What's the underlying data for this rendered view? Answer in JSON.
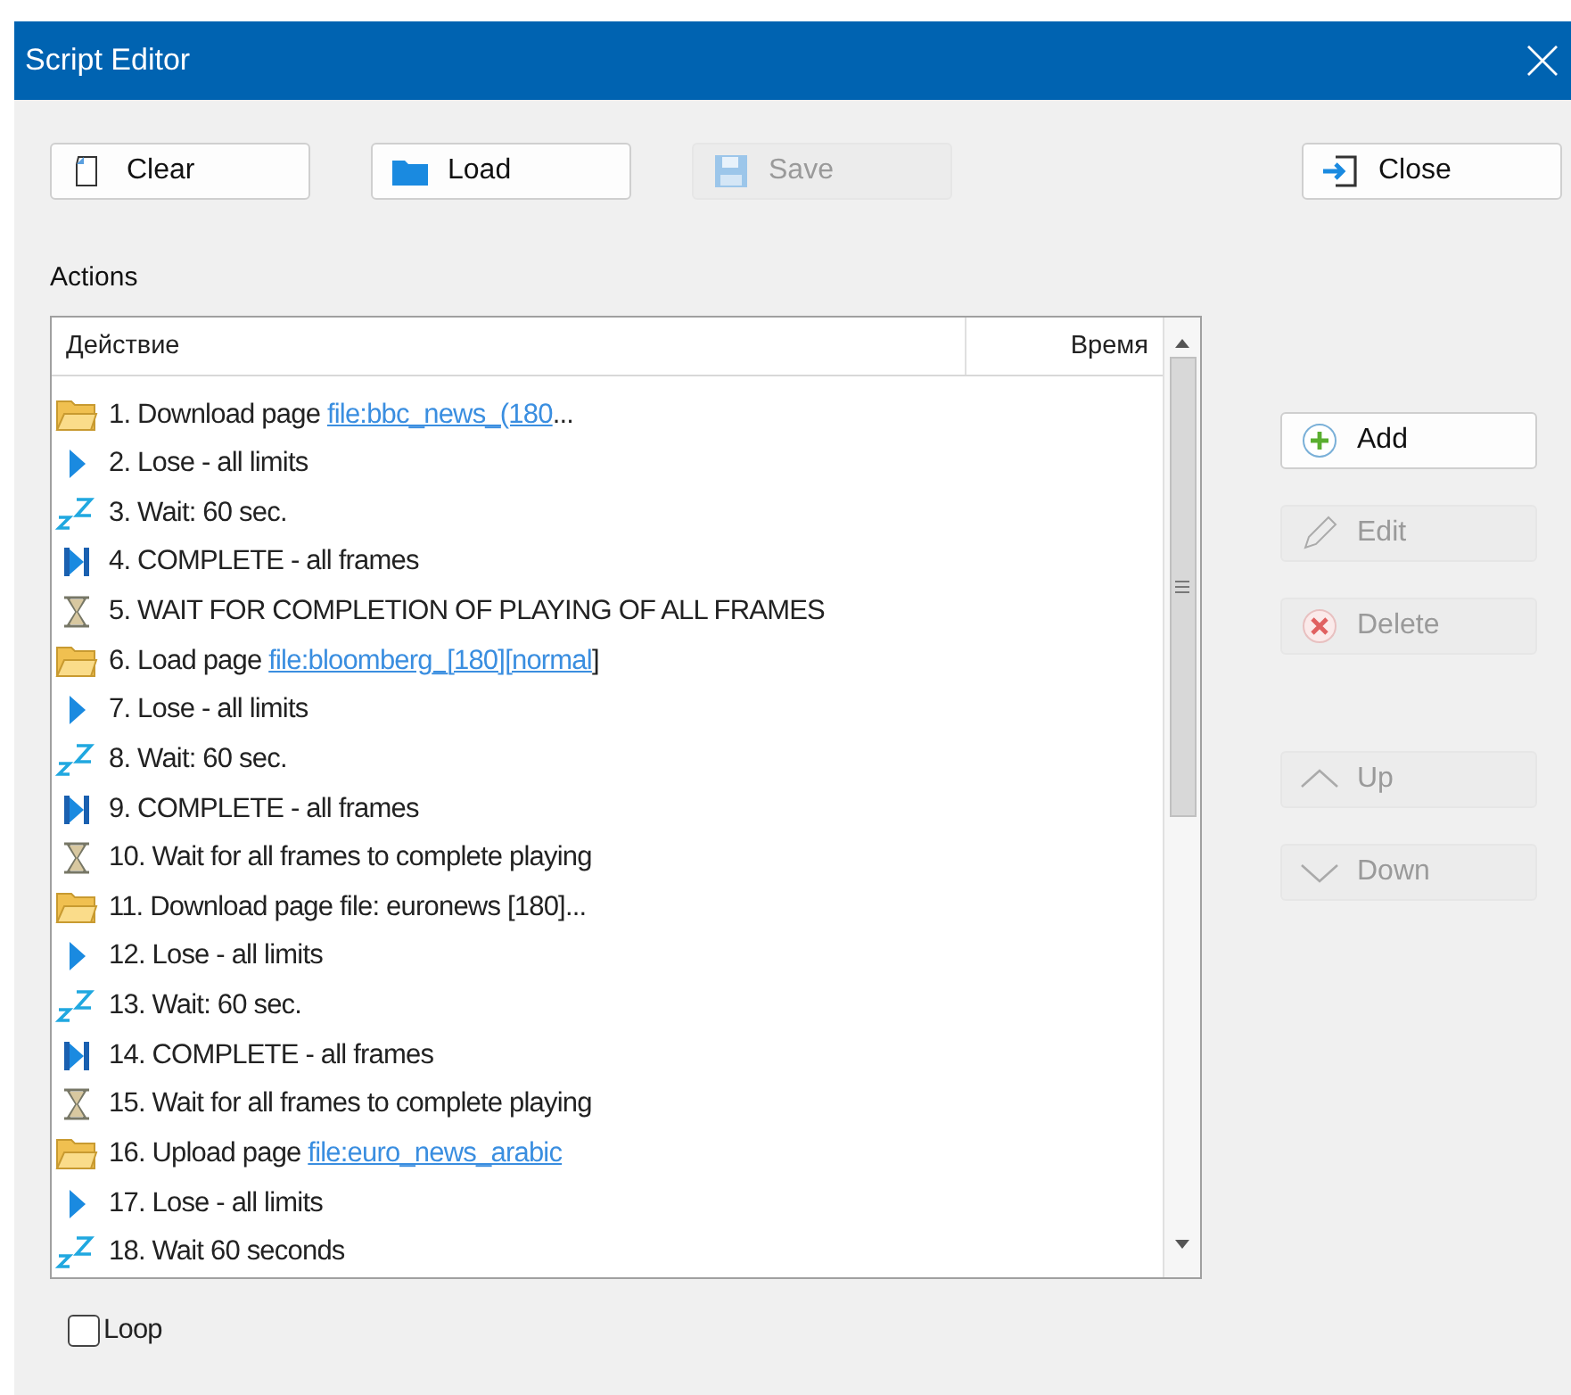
{
  "window": {
    "title": "Script Editor"
  },
  "toolbar": [
    {
      "label": "Clear",
      "kind": "page",
      "disabled": false
    },
    {
      "label": "Load",
      "kind": "folder",
      "disabled": false
    },
    {
      "label": "Save",
      "kind": "disk",
      "disabled": true
    }
  ],
  "close_button": {
    "label": "Close"
  },
  "actions_label": "Actions",
  "table": {
    "columns": [
      "Действие",
      "Время"
    ],
    "rows": [
      {
        "kind": "folder",
        "text": "1. Download page ",
        "link": "file:bbc_news_(180",
        "suffix": "..."
      },
      {
        "kind": "play",
        "text": "2. Lose - all limits"
      },
      {
        "kind": "sleep",
        "text": "3. Wait: 60 sec."
      },
      {
        "kind": "skip",
        "text": "4. COMPLETE - all frames"
      },
      {
        "kind": "hourglass",
        "text": "5. WAIT FOR COMPLETION OF PLAYING OF ALL FRAMES"
      },
      {
        "kind": "folder",
        "text": "6. Load page ",
        "link": "file:bloomberg_[180][normal",
        "suffix": "]"
      },
      {
        "kind": "play",
        "text": "7. Lose - all limits"
      },
      {
        "kind": "sleep",
        "text": "8. Wait: 60 sec."
      },
      {
        "kind": "skip",
        "text": "9. COMPLETE - all frames"
      },
      {
        "kind": "hourglass",
        "text": "10. Wait for all frames to complete playing"
      },
      {
        "kind": "folder",
        "text": "11. Download page file: euronews [180]..."
      },
      {
        "kind": "play",
        "text": "12. Lose - all limits"
      },
      {
        "kind": "sleep",
        "text": "13. Wait: 60 sec."
      },
      {
        "kind": "skip",
        "text": "14. COMPLETE - all frames"
      },
      {
        "kind": "hourglass",
        "text": "15. Wait for all frames to complete playing"
      },
      {
        "kind": "folder",
        "text": "16. Upload page ",
        "link": "file:euro_news_arabic"
      },
      {
        "kind": "play",
        "text": "17. Lose - all limits"
      },
      {
        "kind": "sleep",
        "text": "18. Wait 60 seconds"
      }
    ]
  },
  "side_buttons": [
    {
      "label": "Add",
      "kind": "plus",
      "disabled": false
    },
    {
      "label": "Edit",
      "kind": "pencil",
      "disabled": true
    },
    {
      "label": "Delete",
      "kind": "cross",
      "disabled": true
    },
    {
      "label": "Up",
      "kind": "up",
      "disabled": true
    },
    {
      "label": "Down",
      "kind": "down",
      "disabled": true
    }
  ],
  "loop": {
    "label": "Loop",
    "checked": false
  }
}
